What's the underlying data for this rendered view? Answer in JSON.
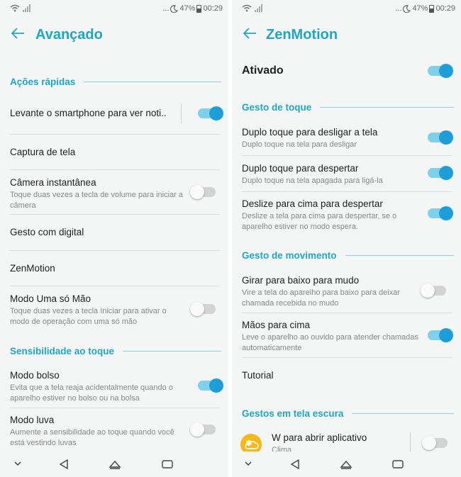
{
  "status": {
    "battery": "47%",
    "time": "00:29",
    "dots": "..."
  },
  "left": {
    "title": "Avançado",
    "sections": {
      "quick": "Ações rápidas",
      "touch": "Sensibilidade ao toque"
    },
    "rows": {
      "raise": {
        "title": "Levante o smartphone para ver noti.."
      },
      "screenshot": {
        "title": "Captura de tela"
      },
      "camera": {
        "title": "Câmera instantânea",
        "subtitle": "Toque duas vezes a tecla de volume para iniciar a câmera"
      },
      "fingerprint": {
        "title": "Gesto com digital"
      },
      "zenmotion": {
        "title": "ZenMotion"
      },
      "onehand": {
        "title": "Modo Uma só Mão",
        "subtitle": "Toque duas vezes a tecla Iniciar para ativar o modo de operação com uma só mão"
      },
      "pocket": {
        "title": "Modo bolso",
        "subtitle": "Evita que a tela reaja acidentalmente quando o aparelho estiver no bolso ou na bolsa"
      },
      "glove": {
        "title": "Modo luva",
        "subtitle": "Aumente a sensibilidade ao toque quando você está vestindo luvas"
      }
    },
    "toggles": {
      "raise": true,
      "camera": false,
      "onehand": false,
      "pocket": true,
      "glove": false
    }
  },
  "right": {
    "title": "ZenMotion",
    "master": {
      "title": "Ativado",
      "on": true
    },
    "sections": {
      "touch": "Gesto de toque",
      "motion": "Gesto de movimento",
      "dark": "Gestos em tela escura"
    },
    "rows": {
      "doubletap_off": {
        "title": "Duplo toque para desligar a tela",
        "subtitle": "Duplo toque na tela para desligar"
      },
      "doubletap_wake": {
        "title": "Duplo toque para despertar",
        "subtitle": "Duplo toque na tela apagada para ligá-la"
      },
      "swipe_up": {
        "title": "Deslize para cima para despertar",
        "subtitle": "Deslize a tela para cima para despertar, se o aparelho estiver no modo espera."
      },
      "flip_mute": {
        "title": "Girar para baixo para mudo",
        "subtitle": "Vire a tela do aparelho para baixo para deixar chamada recebida no mudo"
      },
      "hands_up": {
        "title": "Mãos para cima",
        "subtitle": "Leve o aparelho ao ouvido para atender chamadas automaticamente"
      },
      "tutorial": {
        "title": "Tutorial"
      },
      "w_app": {
        "title": "W para abrir aplicativo",
        "subtitle": "Clima"
      }
    },
    "toggles": {
      "doubletap_off": true,
      "doubletap_wake": true,
      "swipe_up": true,
      "flip_mute": false,
      "hands_up": true,
      "w_app": false
    }
  },
  "colors": {
    "accent": "#1fa6c4",
    "toggle_on_knob": "#1e9ed8",
    "toggle_on_track": "#7fd0ea",
    "weather_icon": "#f5b81c"
  },
  "icons": {
    "wifi": "wifi-icon",
    "signal": "signal-icon",
    "moon": "moon-icon",
    "battery": "battery-icon",
    "back": "back-arrow-icon",
    "nav_down": "chevron-down-icon",
    "nav_back": "triangle-back-icon",
    "nav_home": "home-icon",
    "nav_recents": "recents-icon",
    "weather": "weather-icon"
  }
}
